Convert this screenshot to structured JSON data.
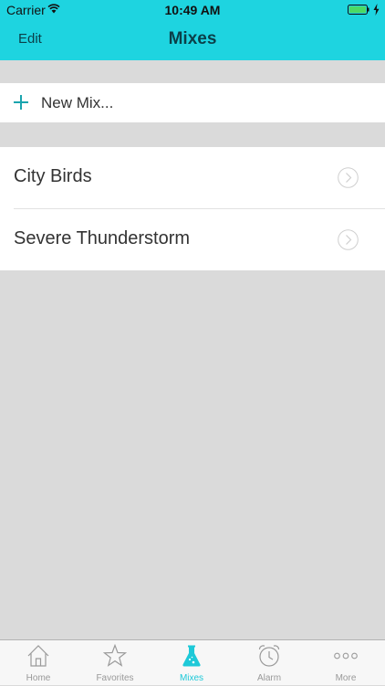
{
  "status_bar": {
    "carrier": "Carrier",
    "time": "10:49 AM"
  },
  "nav": {
    "edit_label": "Edit",
    "title": "Mixes"
  },
  "new_mix": {
    "label": "New Mix..."
  },
  "mixes": [
    {
      "label": "City Birds"
    },
    {
      "label": "Severe Thunderstorm"
    }
  ],
  "tabs": [
    {
      "label": "Home",
      "icon": "home-icon",
      "active": false
    },
    {
      "label": "Favorites",
      "icon": "star-icon",
      "active": false
    },
    {
      "label": "Mixes",
      "icon": "flask-icon",
      "active": true
    },
    {
      "label": "Alarm",
      "icon": "alarm-clock-icon",
      "active": false
    },
    {
      "label": "More",
      "icon": "more-dots-icon",
      "active": false
    }
  ],
  "colors": {
    "accent": "#1ed4e0",
    "nav_text": "#0b3f48",
    "background": "#dadada",
    "tab_active": "#1ec9d8",
    "tab_inactive": "#999999",
    "plus_icon": "#1aa4ae"
  }
}
